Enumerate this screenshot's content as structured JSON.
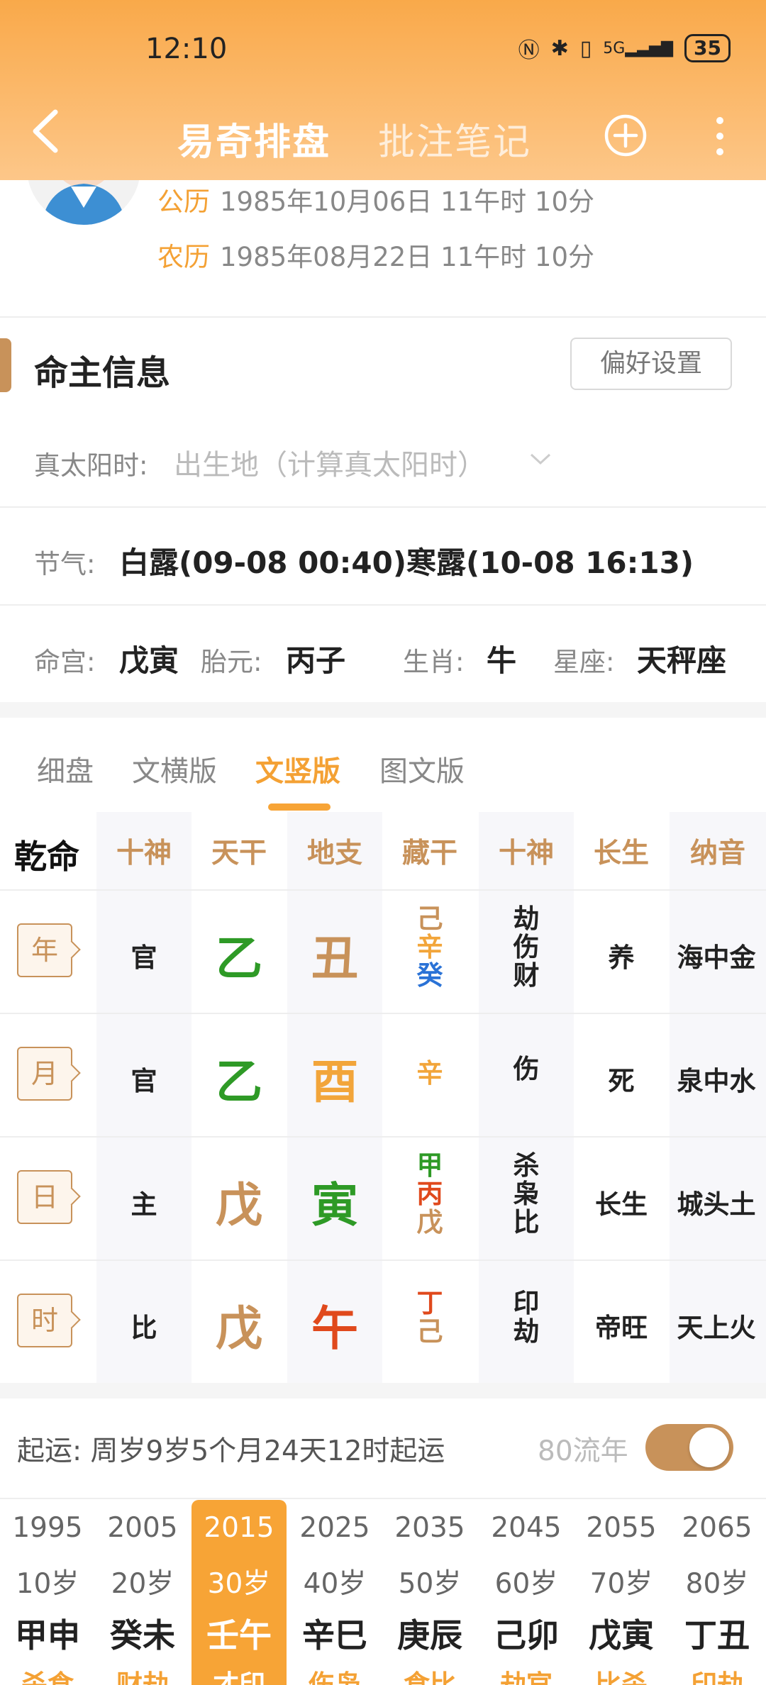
{
  "status": {
    "time": "12:10",
    "battery": "35",
    "network": "5G"
  },
  "header": {
    "title_active": "易奇排盘",
    "title_inactive": "批注笔记"
  },
  "profile": {
    "solar_label": "公历",
    "solar_date": "1985年10月06日 11午时 10分",
    "lunar_label": "农历",
    "lunar_date": "1985年08月22日 11午时 10分"
  },
  "section": {
    "title": "命主信息",
    "pref_button": "偏好设置"
  },
  "true_solar": {
    "label": "真太阳时:",
    "placeholder": "出生地（计算真太阳时）"
  },
  "jieqi": {
    "label": "节气:",
    "value": "白露(09-08 00:40)寒露(10-08 16:13)"
  },
  "palace": {
    "minggong_label": "命宫:",
    "minggong": "戊寅",
    "taiyuan_label": "胎元:",
    "taiyuan": "丙子",
    "shengxiao_label": "生肖:",
    "shengxiao": "牛",
    "xingzuo_label": "星座:",
    "xingzuo": "天秤座"
  },
  "tabs": [
    "细盘",
    "文横版",
    "文竖版",
    "图文版"
  ],
  "active_tab": "文竖版",
  "grid": {
    "corner": "乾命",
    "headers": [
      "十神",
      "天干",
      "地支",
      "藏干",
      "十神",
      "长生",
      "纳音"
    ],
    "rows": [
      {
        "pillar": "年",
        "shishen": "官",
        "gan": "乙",
        "zhi": "丑",
        "canggan": [
          "己",
          "辛",
          "癸"
        ],
        "canggan_colors": [
          "#c8925a",
          "#f2a53a",
          "#2a72d6"
        ],
        "shishen2": [
          "劫",
          "伤",
          "财"
        ],
        "changsheng": "养",
        "nayin": "海中金"
      },
      {
        "pillar": "月",
        "shishen": "官",
        "gan": "乙",
        "zhi": "酉",
        "canggan": [
          "辛"
        ],
        "canggan_colors": [
          "#f2a53a"
        ],
        "shishen2": [
          "伤"
        ],
        "changsheng": "死",
        "nayin": "泉中水"
      },
      {
        "pillar": "日",
        "shishen": "主",
        "gan": "戊",
        "zhi": "寅",
        "canggan": [
          "甲",
          "丙",
          "戊"
        ],
        "canggan_colors": [
          "#2e9a26",
          "#e0491c",
          "#c8925a"
        ],
        "shishen2": [
          "杀",
          "枭",
          "比"
        ],
        "changsheng": "长生",
        "nayin": "城头土"
      },
      {
        "pillar": "时",
        "shishen": "比",
        "gan": "戊",
        "zhi": "午",
        "canggan": [
          "丁",
          "己"
        ],
        "canggan_colors": [
          "#e0491c",
          "#c8925a"
        ],
        "shishen2": [
          "印",
          "劫"
        ],
        "changsheng": "帝旺",
        "nayin": "天上火"
      }
    ]
  },
  "qiyun": {
    "label": "起运:",
    "value": "周岁9岁5个月24天12时起运",
    "liunian_label": "80流年",
    "toggle_on": true
  },
  "decades": [
    {
      "year": "1995",
      "age": "10岁",
      "ganzhi": "甲申",
      "shishen": "杀食"
    },
    {
      "year": "2005",
      "age": "20岁",
      "ganzhi": "癸未",
      "shishen": "财劫"
    },
    {
      "year": "2015",
      "age": "30岁",
      "ganzhi": "壬午",
      "shishen": "才印",
      "active": true
    },
    {
      "year": "2025",
      "age": "40岁",
      "ganzhi": "辛巳",
      "shishen": "伤枭"
    },
    {
      "year": "2035",
      "age": "50岁",
      "ganzhi": "庚辰",
      "shishen": "食比"
    },
    {
      "year": "2045",
      "age": "60岁",
      "ganzhi": "己卯",
      "shishen": "劫官"
    },
    {
      "year": "2055",
      "age": "70岁",
      "ganzhi": "戊寅",
      "shishen": "比杀"
    },
    {
      "year": "2065",
      "age": "80岁",
      "ganzhi": "丁丑",
      "shishen": "印劫"
    }
  ],
  "colors": {
    "accent": "#f7a436",
    "tan": "#c8925a",
    "green": "#2e9a26",
    "red": "#e0491c",
    "orange": "#f2a53a",
    "blue": "#2a72d6"
  }
}
